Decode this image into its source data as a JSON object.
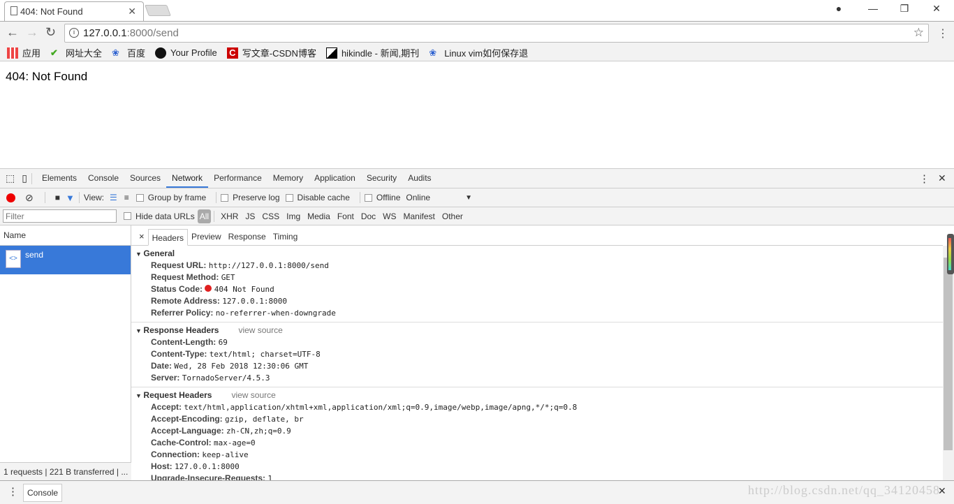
{
  "browser": {
    "tab_title": "404: Not Found",
    "url_host": "127.0.0.1",
    "url_rest": ":8000/send",
    "bookmarks": [
      {
        "label": "应用",
        "icon": "apps-grid-icon"
      },
      {
        "label": "网址大全",
        "icon": "hao123-icon"
      },
      {
        "label": "百度",
        "icon": "baidu-paw-icon"
      },
      {
        "label": "Your Profile",
        "icon": "github-icon"
      },
      {
        "label": "写文章-CSDN博客",
        "icon": "csdn-icon"
      },
      {
        "label": "hikindle - 新闻,期刊",
        "icon": "hikindle-icon"
      },
      {
        "label": "Linux vim如何保存退",
        "icon": "baidu-paw-icon"
      }
    ]
  },
  "page": {
    "heading": "404: Not Found"
  },
  "devtools": {
    "tabs": [
      "Elements",
      "Console",
      "Sources",
      "Network",
      "Performance",
      "Memory",
      "Application",
      "Security",
      "Audits"
    ],
    "active_tab": "Network",
    "toolbar": {
      "view_label": "View:",
      "group_by_frame": "Group by frame",
      "preserve_log": "Preserve log",
      "disable_cache": "Disable cache",
      "offline": "Offline",
      "throttle": "Online"
    },
    "filter": {
      "placeholder": "Filter",
      "hide_data_urls": "Hide data URLs",
      "types": [
        "All",
        "XHR",
        "JS",
        "CSS",
        "Img",
        "Media",
        "Font",
        "Doc",
        "WS",
        "Manifest",
        "Other"
      ]
    },
    "name_header": "Name",
    "request_name": "send",
    "status_bar": "1 requests | 221 B transferred | ...",
    "detail_tabs": [
      "Headers",
      "Preview",
      "Response",
      "Timing"
    ],
    "general": {
      "title": "General",
      "rows": [
        {
          "k": "Request URL:",
          "v": "http://127.0.0.1:8000/send"
        },
        {
          "k": "Request Method:",
          "v": "GET"
        },
        {
          "k": "Status Code:",
          "v": "404 Not Found"
        },
        {
          "k": "Remote Address:",
          "v": "127.0.0.1:8000"
        },
        {
          "k": "Referrer Policy:",
          "v": "no-referrer-when-downgrade"
        }
      ]
    },
    "response_headers": {
      "title": "Response Headers",
      "view_source": "view source",
      "rows": [
        {
          "k": "Content-Length:",
          "v": "69"
        },
        {
          "k": "Content-Type:",
          "v": "text/html; charset=UTF-8"
        },
        {
          "k": "Date:",
          "v": "Wed, 28 Feb 2018 12:30:06 GMT"
        },
        {
          "k": "Server:",
          "v": "TornadoServer/4.5.3"
        }
      ]
    },
    "request_headers": {
      "title": "Request Headers",
      "view_source": "view source",
      "rows": [
        {
          "k": "Accept:",
          "v": "text/html,application/xhtml+xml,application/xml;q=0.9,image/webp,image/apng,*/*;q=0.8"
        },
        {
          "k": "Accept-Encoding:",
          "v": "gzip, deflate, br"
        },
        {
          "k": "Accept-Language:",
          "v": "zh-CN,zh;q=0.9"
        },
        {
          "k": "Cache-Control:",
          "v": "max-age=0"
        },
        {
          "k": "Connection:",
          "v": "keep-alive"
        },
        {
          "k": "Host:",
          "v": "127.0.0.1:8000"
        },
        {
          "k": "Upgrade-Insecure-Requests:",
          "v": "1"
        }
      ]
    },
    "drawer_tab": "Console",
    "status_color": "#e02020",
    "accent": "#3879d9"
  },
  "watermark": "http://blog.csdn.net/qq_34120458"
}
